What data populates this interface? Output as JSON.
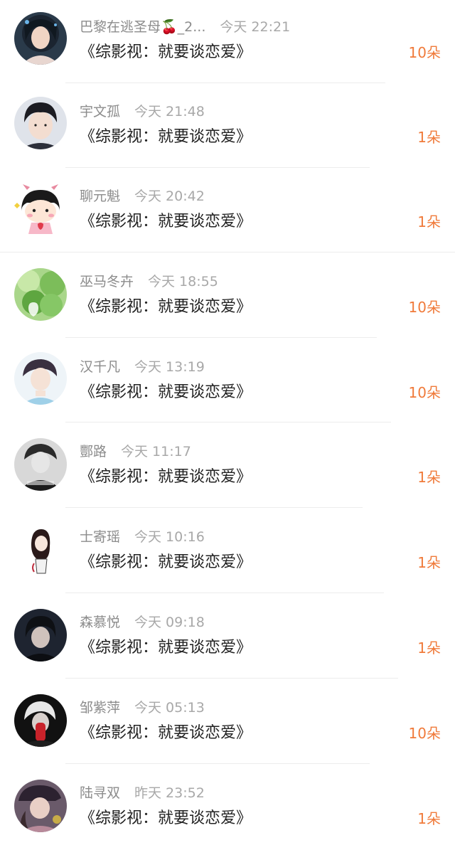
{
  "theme": {
    "accent": "#f07a3a",
    "text_primary": "#222222",
    "text_secondary": "#8c8c8c"
  },
  "gifts": [
    {
      "name": "巴黎在逃圣母🍒_2...",
      "time": "今天 22:21",
      "book": "《综影视：就要谈恋爱》",
      "count": "10朵",
      "avatar": "girl-portrait-avatar"
    },
    {
      "name": "宇文孤",
      "time": "今天 21:48",
      "book": "《综影视：就要谈恋爱》",
      "count": "1朵",
      "avatar": "boy-portrait-avatar"
    },
    {
      "name": "聊元魁",
      "time": "今天 20:42",
      "book": "《综影视：就要谈恋爱》",
      "count": "1朵",
      "avatar": "cartoon-girl-avatar"
    },
    {
      "name": "巫马冬卉",
      "time": "今天 18:55",
      "book": "《综影视：就要谈恋爱》",
      "count": "10朵",
      "avatar": "clover-avatar"
    },
    {
      "name": "汉千凡",
      "time": "今天 13:19",
      "book": "《综影视：就要谈恋爱》",
      "count": "10朵",
      "avatar": "anime-boy-avatar"
    },
    {
      "name": "酆路",
      "time": "今天 11:17",
      "book": "《综影视：就要谈恋爱》",
      "count": "1朵",
      "avatar": "monochrome-boy-avatar"
    },
    {
      "name": "士寄瑶",
      "time": "今天 10:16",
      "book": "《综影视：就要谈恋爱》",
      "count": "1朵",
      "avatar": "sketch-girl-avatar"
    },
    {
      "name": "森慕悦",
      "time": "今天 09:18",
      "book": "《综影视：就要谈恋爱》",
      "count": "1朵",
      "avatar": "dark-portrait-avatar"
    },
    {
      "name": "邹紫萍",
      "time": "今天 05:13",
      "book": "《综影视：就要谈恋爱》",
      "count": "10朵",
      "avatar": "red-hand-avatar"
    },
    {
      "name": "陆寻双",
      "time": "昨天 23:52",
      "book": "《综影视：就要谈恋爱》",
      "count": "1朵",
      "avatar": "cap-girl-avatar"
    }
  ]
}
